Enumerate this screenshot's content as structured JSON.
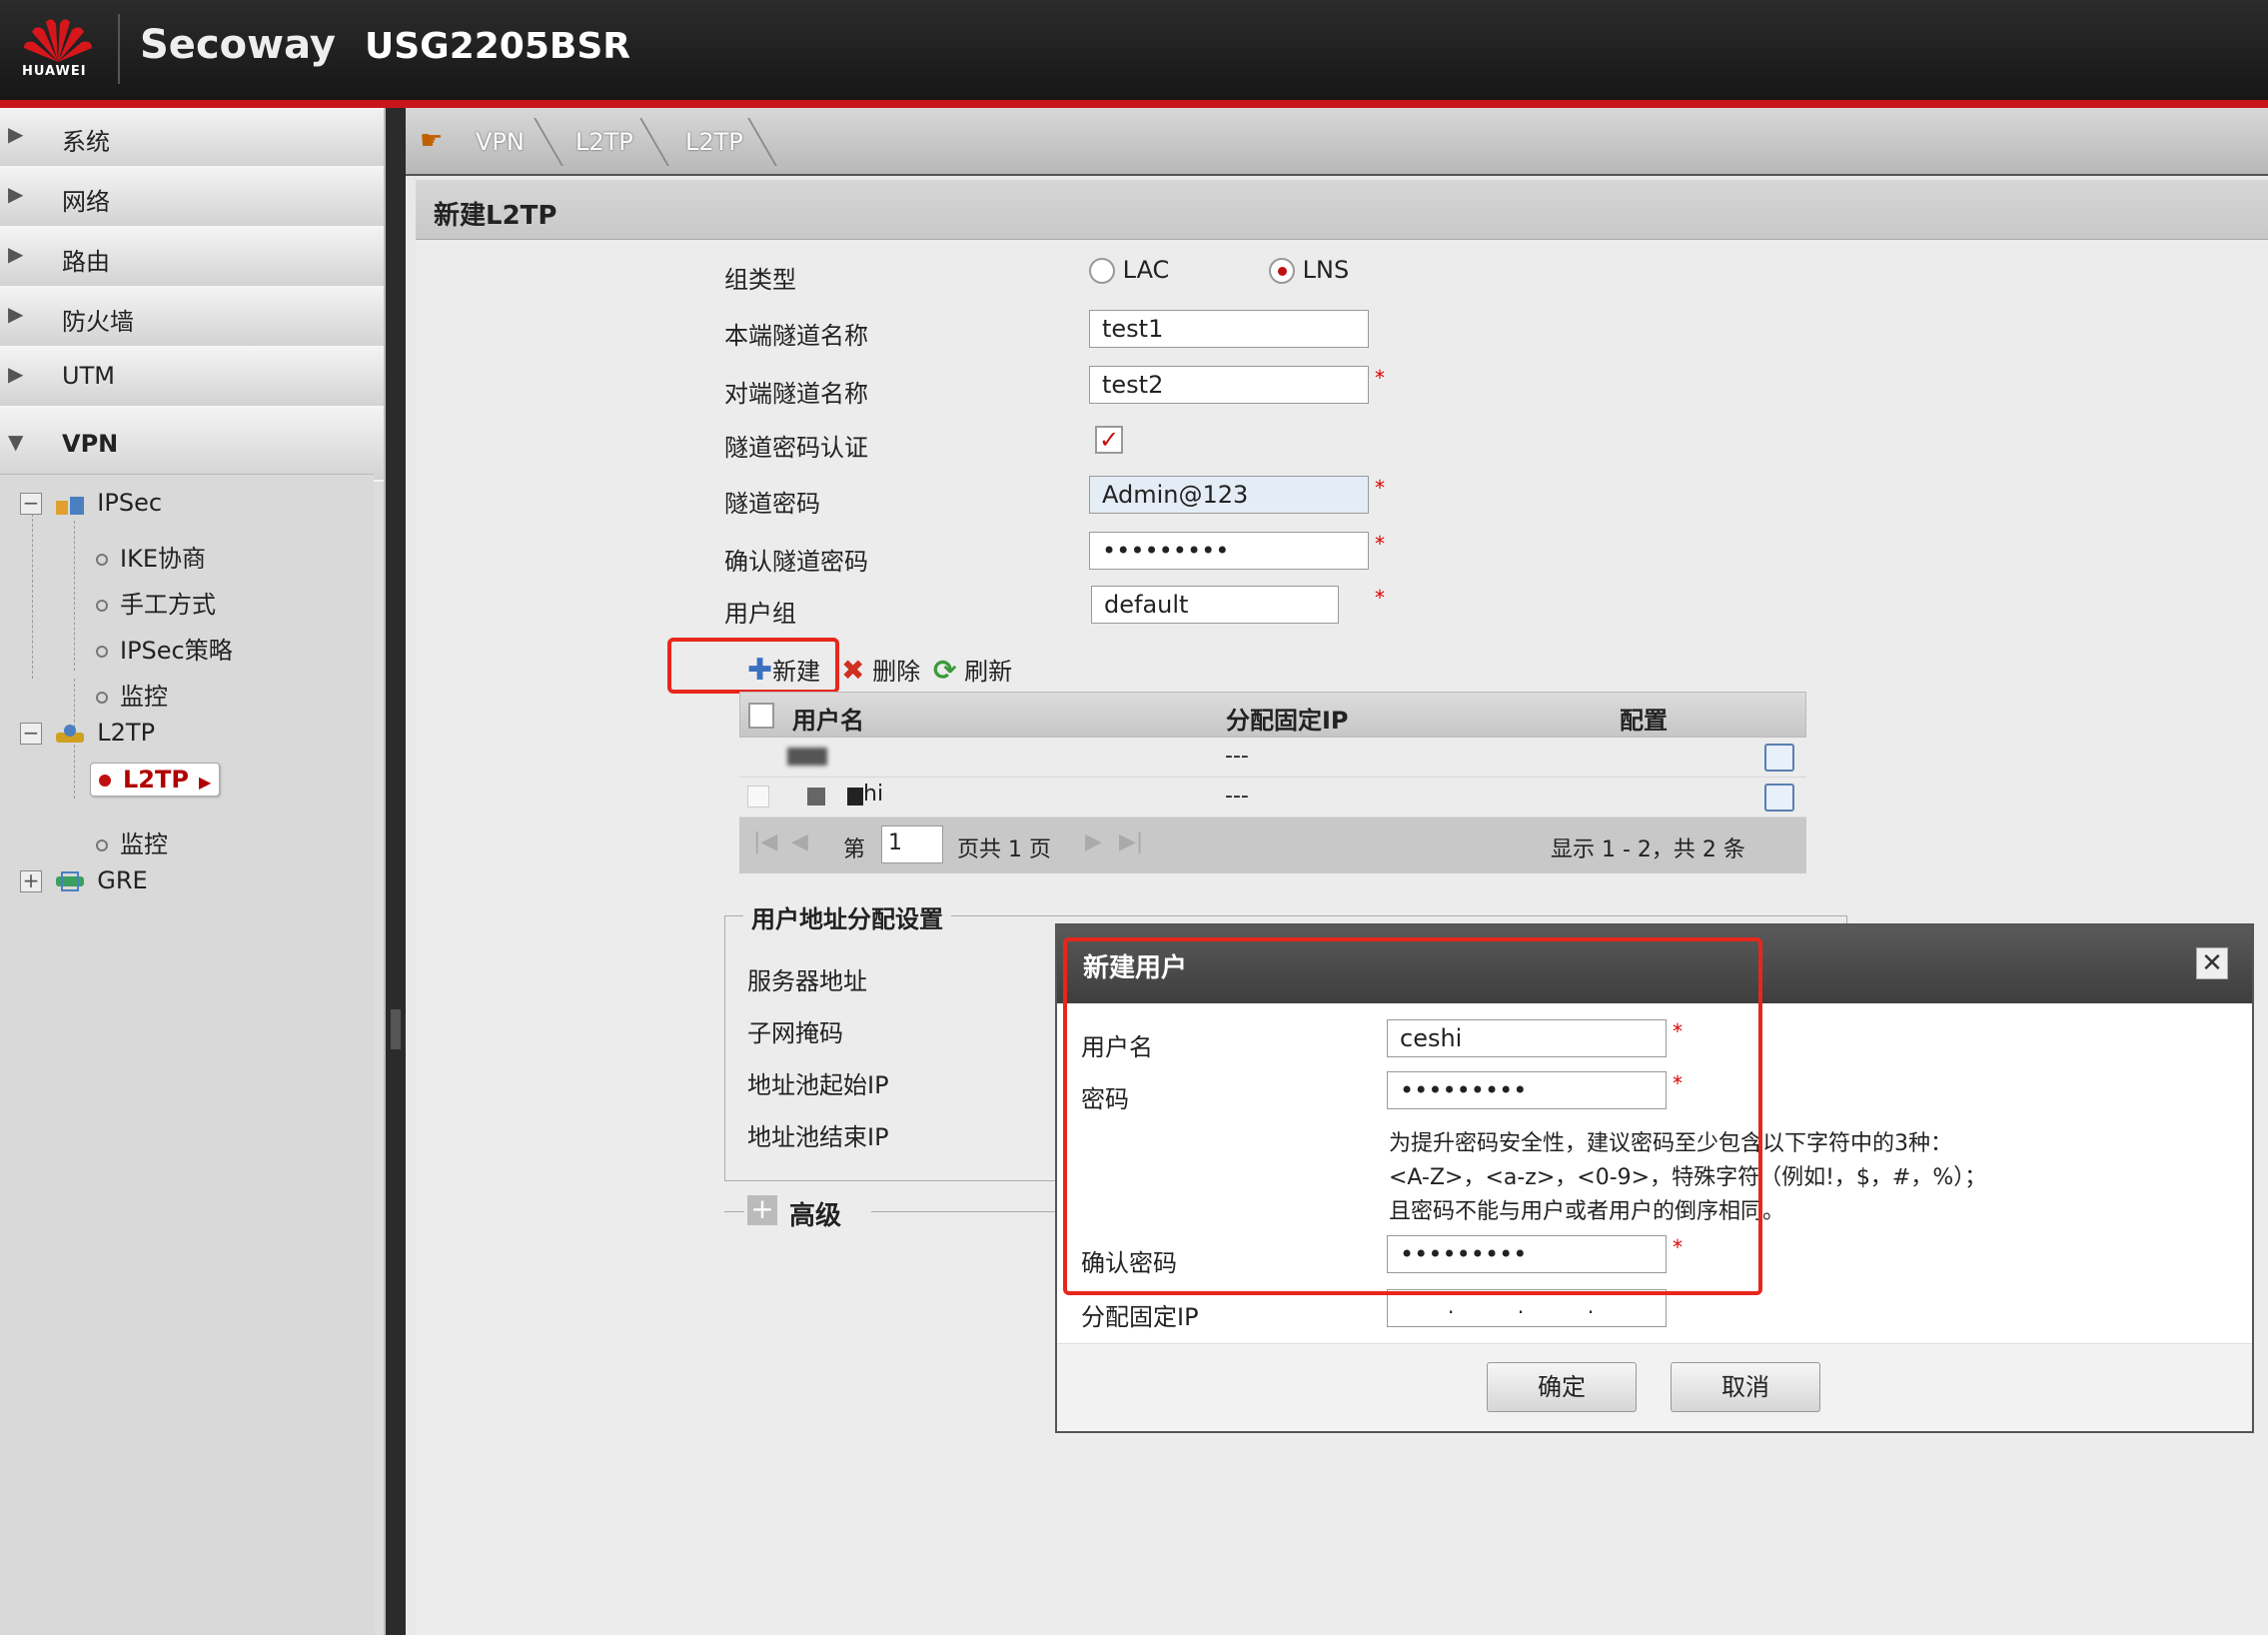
{
  "app": {
    "brand_mark": "HUAWEI",
    "brand": "Secoway",
    "model": "USG2205BSR"
  },
  "nav": {
    "menus": [
      "系统",
      "网络",
      "路由",
      "防火墙",
      "UTM",
      "VPN"
    ],
    "tree": {
      "ipsec": "IPSec",
      "ike": "IKE协商",
      "manual": "手工方式",
      "policy": "IPSec策略",
      "monitor1": "监控",
      "l2tp": "L2TP",
      "l2tp_item": "L2TP",
      "monitor2": "监控",
      "gre": "GRE"
    }
  },
  "breadcrumb": [
    "VPN",
    "L2TP",
    "L2TP"
  ],
  "page": {
    "title": "新建L2TP",
    "group_type_label": "组类型",
    "lac": "LAC",
    "lns": "LNS",
    "local_name_label": "本端隧道名称",
    "local_name": "test1",
    "peer_name_label": "对端隧道名称",
    "peer_name": "test2",
    "auth_label": "隧道密码认证",
    "pwd_label": "隧道密码",
    "pwd": "Admin@123",
    "confirm_label": "确认隧道密码",
    "confirm": "•••••••••",
    "usergroup_label": "用户组",
    "usergroup": "default",
    "star": "*"
  },
  "toolbar": {
    "new": "新建",
    "delete": "删除",
    "refresh": "刷新"
  },
  "table": {
    "headers": [
      "用户名",
      "分配固定IP",
      "配置"
    ],
    "rows": [
      {
        "ip": "---"
      },
      {
        "user": "hi",
        "ip": "---"
      }
    ],
    "pager": {
      "page_prefix": "第",
      "page": "1",
      "page_suffix": "页共 1 页",
      "summary": "显示 1 - 2，共 2 条"
    }
  },
  "address": {
    "legend": "用户地址分配设置",
    "server": "服务器地址",
    "mask": "子网掩码",
    "start": "地址池起始IP",
    "end": "地址池结束IP",
    "advanced": "高级"
  },
  "dialog": {
    "title": "新建用户",
    "close": "✕",
    "username_label": "用户名",
    "username": "ceshi",
    "password_label": "密码",
    "password": "•••••••••",
    "hint1": "为提升密码安全性，建议密码至少包含以下字符中的3种：",
    "hint2": "<A-Z>，<a-z>，<0-9>，特殊字符（例如!，$，#，%）；",
    "hint3": "且密码不能与用户或者用户的倒序相同。",
    "confirm_label": "确认密码",
    "confirm": "•••••••••",
    "ip_label": "分配固定IP",
    "ip_dots": ".          .          .",
    "ok": "确定",
    "cancel": "取消"
  },
  "colors": {
    "accent": "#c9141a",
    "annotation": "#e8261c"
  }
}
